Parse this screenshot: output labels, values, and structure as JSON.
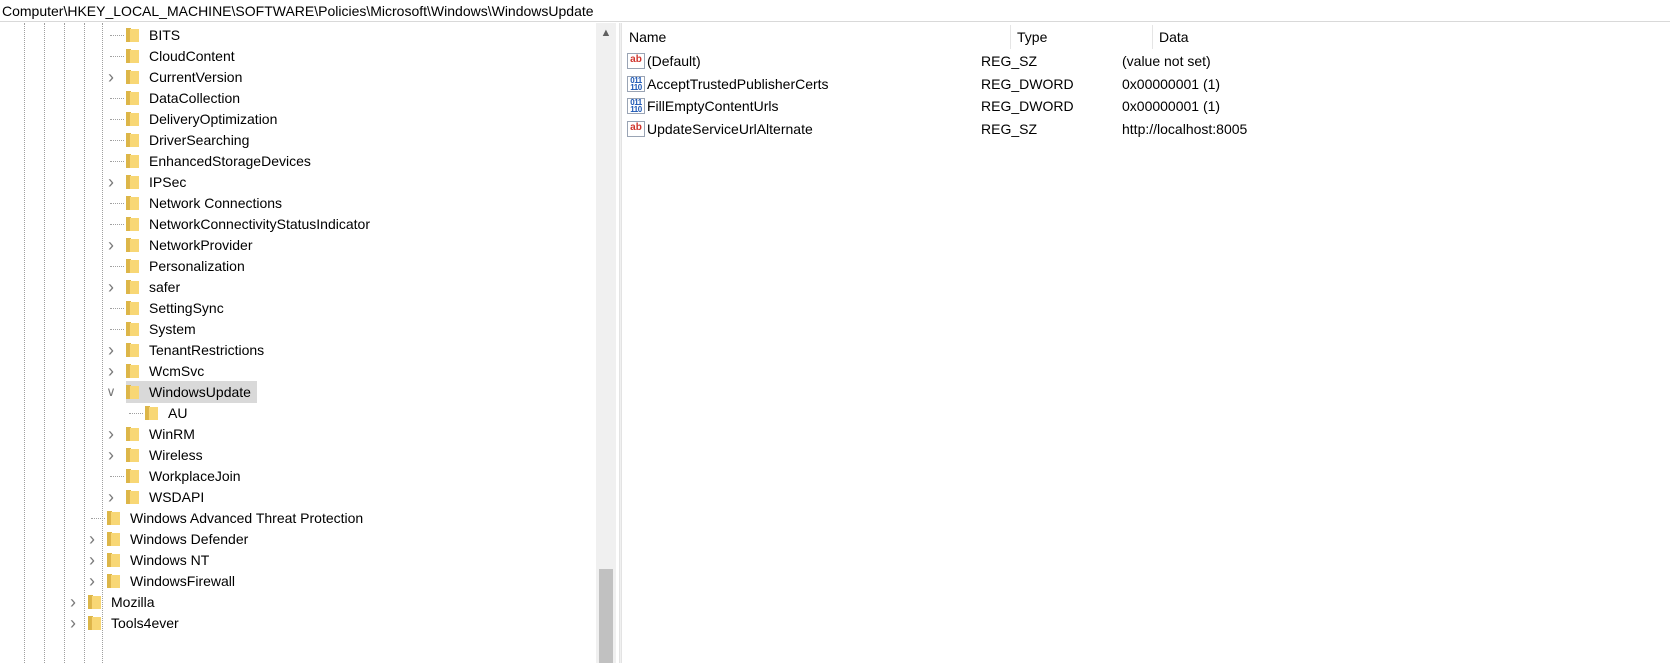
{
  "address": "Computer\\HKEY_LOCAL_MACHINE\\SOFTWARE\\Policies\\Microsoft\\Windows\\WindowsUpdate",
  "tree": [
    {
      "label": "BITS",
      "expandable": false
    },
    {
      "label": "CloudContent",
      "expandable": false
    },
    {
      "label": "CurrentVersion",
      "expandable": true
    },
    {
      "label": "DataCollection",
      "expandable": false
    },
    {
      "label": "DeliveryOptimization",
      "expandable": false
    },
    {
      "label": "DriverSearching",
      "expandable": false
    },
    {
      "label": "EnhancedStorageDevices",
      "expandable": false
    },
    {
      "label": "IPSec",
      "expandable": true
    },
    {
      "label": "Network Connections",
      "expandable": false
    },
    {
      "label": "NetworkConnectivityStatusIndicator",
      "expandable": false
    },
    {
      "label": "NetworkProvider",
      "expandable": true
    },
    {
      "label": "Personalization",
      "expandable": false
    },
    {
      "label": "safer",
      "expandable": true
    },
    {
      "label": "SettingSync",
      "expandable": false
    },
    {
      "label": "System",
      "expandable": false
    },
    {
      "label": "TenantRestrictions",
      "expandable": true
    },
    {
      "label": "WcmSvc",
      "expandable": true
    },
    {
      "label": "WindowsUpdate",
      "expandable": true,
      "expanded": true,
      "selected": true
    },
    {
      "label": "AU",
      "expandable": false
    },
    {
      "label": "WinRM",
      "expandable": true
    },
    {
      "label": "Wireless",
      "expandable": true
    },
    {
      "label": "WorkplaceJoin",
      "expandable": false
    },
    {
      "label": "WSDAPI",
      "expandable": true
    },
    {
      "label": "Windows Advanced Threat Protection",
      "expandable": false
    },
    {
      "label": "Windows Defender",
      "expandable": true
    },
    {
      "label": "Windows NT",
      "expandable": true
    },
    {
      "label": "WindowsFirewall",
      "expandable": true
    },
    {
      "label": "Mozilla",
      "expandable": true
    },
    {
      "label": "Tools4ever",
      "expandable": true
    }
  ],
  "columns": {
    "name": "Name",
    "type": "Type",
    "data": "Data"
  },
  "values": [
    {
      "icon": "string-value-icon",
      "name": "(Default)",
      "type": "REG_SZ",
      "data": "(value not set)"
    },
    {
      "icon": "dword-value-icon",
      "name": "AcceptTrustedPublisherCerts",
      "type": "REG_DWORD",
      "data": "0x00000001 (1)"
    },
    {
      "icon": "dword-value-icon",
      "name": "FillEmptyContentUrls",
      "type": "REG_DWORD",
      "data": "0x00000001 (1)"
    },
    {
      "icon": "string-value-icon",
      "name": "UpdateServiceUrlAlternate",
      "type": "REG_SZ",
      "data": "http://localhost:8005"
    }
  ]
}
